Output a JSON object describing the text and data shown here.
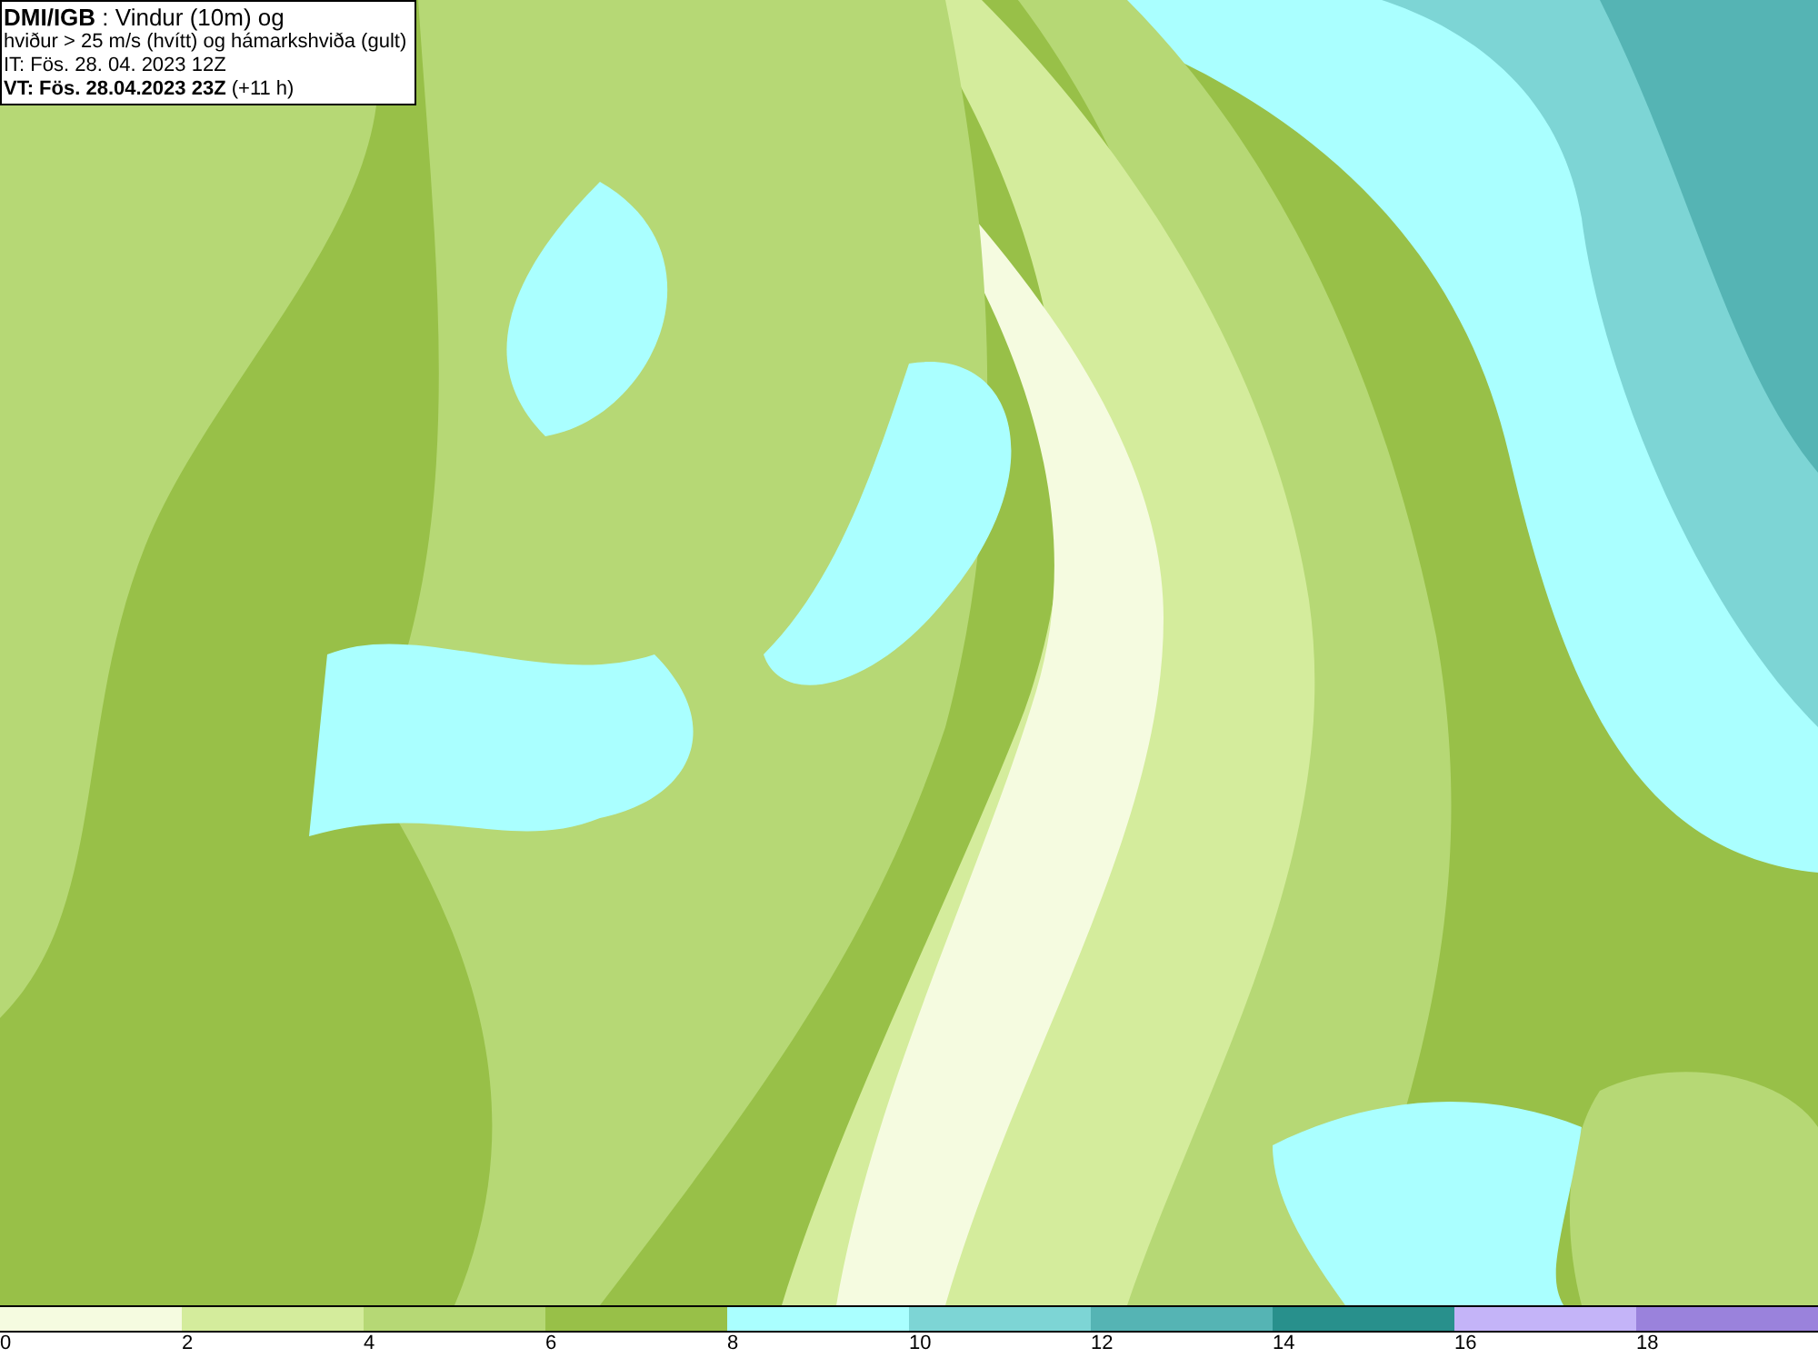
{
  "header": {
    "lines": [
      "**DMI/IGB** : Vindur (10m) og",
      "hviður > 25 m/s (hvítt) og hámarkshviða (gult)",
      "IT: Fös. 28. 04. 2023 12Z",
      "**VT: Fös. 28.04.2023 23Z** (+11 h)"
    ]
  },
  "legend": {
    "bins": [
      {
        "color": "#f5fbe0",
        "label": "0"
      },
      {
        "color": "#d4ec9c",
        "label": "2"
      },
      {
        "color": "#b6d875",
        "label": "4"
      },
      {
        "color": "#98c048",
        "label": "6"
      },
      {
        "color": "#aaffff",
        "label": "8"
      },
      {
        "color": "#7dd5d5",
        "label": "10"
      },
      {
        "color": "#55b4b4",
        "label": "12"
      },
      {
        "color": "#28908c",
        "label": "14"
      },
      {
        "color": "#c4b4f8",
        "label": "16"
      },
      {
        "color": "#9a82dc",
        "label": "18"
      }
    ]
  }
}
